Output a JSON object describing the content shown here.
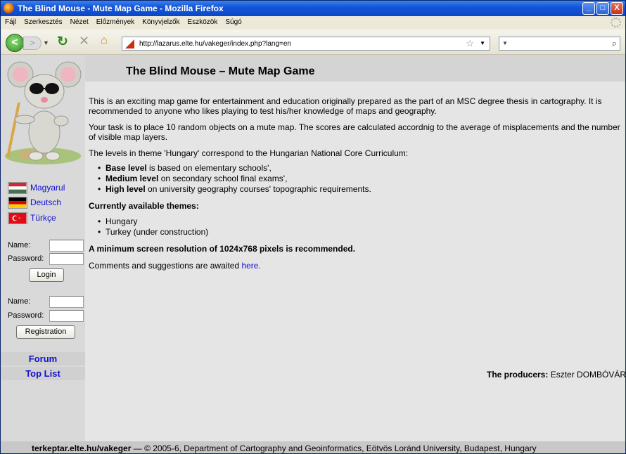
{
  "window": {
    "title": "The Blind Mouse - Mute Map Game - Mozilla Firefox",
    "minimize_label": "_",
    "maximize_label": "□",
    "close_label": "X"
  },
  "menu": [
    "Fájl",
    "Szerkesztés",
    "Nézet",
    "Előzmények",
    "Könyvjelzők",
    "Eszközök",
    "Súgó"
  ],
  "nav": {
    "back": "<",
    "forward": ">",
    "url": "http://lazarus.elte.hu/vakeger/index.php?lang=en"
  },
  "page": {
    "heading": "The Blind Mouse – Mute Map Game",
    "intro1": "This is an exciting map game for entertainment and education originally prepared as the part of an MSC degree thesis in cartography. It is recommended to anyone who likes playing to test his/her knowledge of maps and geography.",
    "intro2": "Your task is to place 10 random objects on a mute map. The scores are calculated accordnig to the average of misplacements and the number of visible map layers.",
    "levels_intro": "The levels in theme 'Hungary' correspond to the Hungarian National Core Curriculum:",
    "levels": [
      {
        "name": "Base level",
        "desc": " is based on elementary schools',"
      },
      {
        "name": "Medium level",
        "desc": " on secondary school final exams',"
      },
      {
        "name": "High level",
        "desc": " on university geography courses' topographic requirements."
      }
    ],
    "themes_heading": "Currently available themes:",
    "themes": [
      "Hungary",
      "Turkey (under construction)"
    ],
    "resolution_note": "A minimum screen resolution of 1024x768 pixels is recommended.",
    "comments_text": "Comments and suggestions are awaited ",
    "comments_link": "here.",
    "producers_label": "The producers:",
    "producers_names": " Eszter DOMBÓVÁRI, Mátyás GEDE",
    "footer_site": "terkeptar.elte.hu/vakeger",
    "footer_text": " — © 2005-6, Department of Cartography and Geoinformatics, Eötvös Loránd University, Budapest, Hungary"
  },
  "sidebar": {
    "languages": [
      "Magyarul",
      "Deutsch",
      "Türkçe"
    ],
    "login": {
      "name_label": "Name:",
      "password_label": "Password:",
      "button": "Login"
    },
    "registration": {
      "name_label": "Name:",
      "password_label": "Password:",
      "button": "Registration"
    },
    "links": [
      "Forum",
      "Top List"
    ]
  }
}
